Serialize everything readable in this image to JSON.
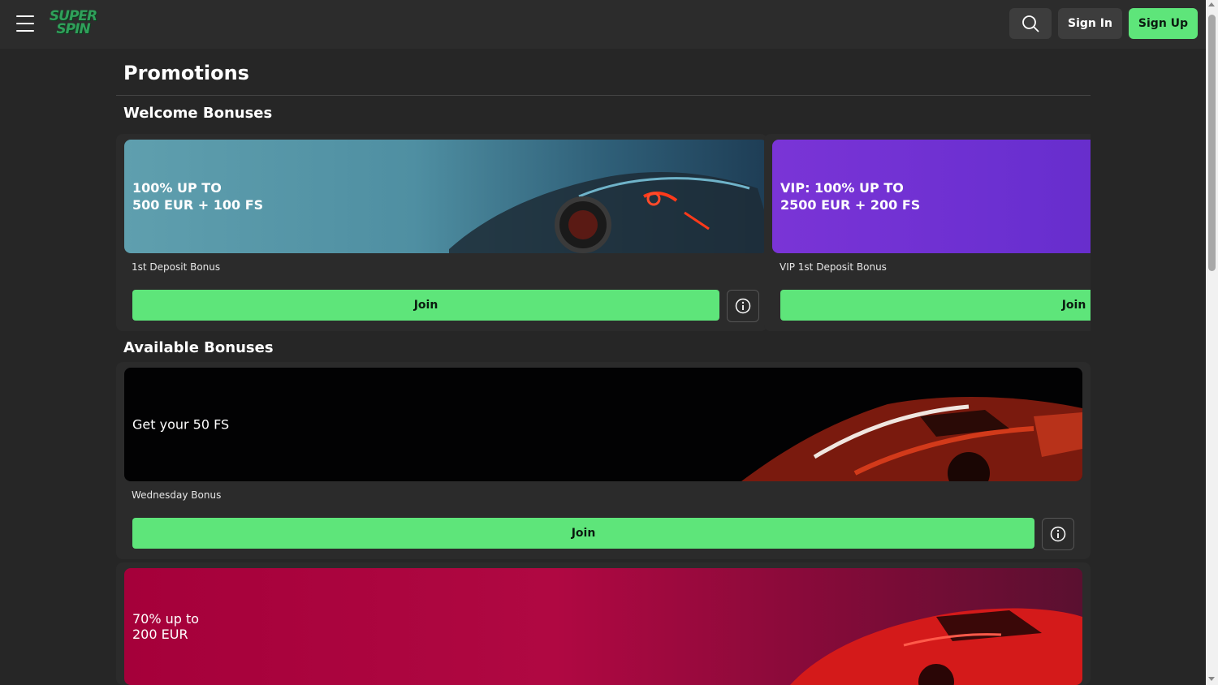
{
  "header": {
    "logo_line1": "SUPER",
    "logo_line2": "SPIN",
    "sign_in": "Sign In",
    "sign_up": "Sign Up"
  },
  "page": {
    "title": "Promotions"
  },
  "welcome": {
    "title": "Welcome Bonuses",
    "cards": [
      {
        "banner": "100% UP TO\n500 EUR + 100 FS",
        "subtitle": "1st Deposit Bonus",
        "join": "Join"
      },
      {
        "banner": "VIP: 100% UP TO\n2500 EUR + 200 FS",
        "subtitle": "VIP 1st Deposit Bonus",
        "join": "Join"
      }
    ]
  },
  "available": {
    "title": "Available Bonuses",
    "cards": [
      {
        "banner": "Get your 50 FS",
        "subtitle": "Wednesday Bonus",
        "join": "Join"
      },
      {
        "banner": "70% up to\n200 EUR"
      }
    ]
  },
  "colors": {
    "accent_green": "#5ee57a",
    "background": "#262626",
    "vip_purple": "#6a2fd0",
    "promo_red": "#a8003c"
  },
  "icons": {
    "menu": "hamburger-icon",
    "search": "search-icon",
    "info": "info-icon"
  }
}
